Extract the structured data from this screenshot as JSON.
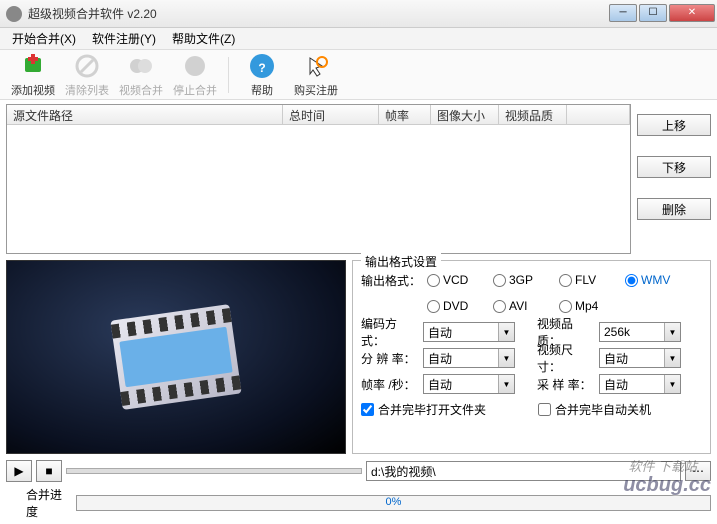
{
  "window": {
    "title": "超级视频合并软件 v2.20"
  },
  "menu": {
    "start": "开始合并(X)",
    "register": "软件注册(Y)",
    "help": "帮助文件(Z)"
  },
  "toolbar": {
    "add": "添加视频",
    "clear": "清除列表",
    "merge": "视频合并",
    "stop": "停止合并",
    "help": "帮助",
    "buy": "购买注册"
  },
  "columns": {
    "path": "源文件路径",
    "duration": "总时间",
    "fps": "帧率",
    "size": "图像大小",
    "quality": "视频品质"
  },
  "sidebtns": {
    "up": "上移",
    "down": "下移",
    "delete": "删除"
  },
  "output": {
    "group_title": "输出格式设置",
    "format_label": "输出格式：",
    "formats": {
      "vcd": "VCD",
      "3gp": "3GP",
      "flv": "FLV",
      "wmv": "WMV",
      "dvd": "DVD",
      "avi": "AVI",
      "mp4": "Mp4"
    },
    "selected_format": "wmv",
    "encode_label": "编码方式：",
    "encode_value": "自动",
    "vquality_label": "视频品质：",
    "vquality_value": "256k",
    "resolution_label": "分 辨 率：",
    "resolution_value": "自动",
    "vsize_label": "视频尺寸：",
    "vsize_value": "自动",
    "fps_label": "帧率 /秒：",
    "fps_value": "自动",
    "sample_label": "采 样 率：",
    "sample_value": "自动",
    "open_after": "合并完毕打开文件夹",
    "shutdown_after": "合并完毕自动关机"
  },
  "path": {
    "value": "d:\\我的视频\\"
  },
  "progress": {
    "label": "合并进度",
    "percent": "0%"
  },
  "watermark": {
    "cn": "软件 下载站",
    "en": "ucbug.cc"
  }
}
